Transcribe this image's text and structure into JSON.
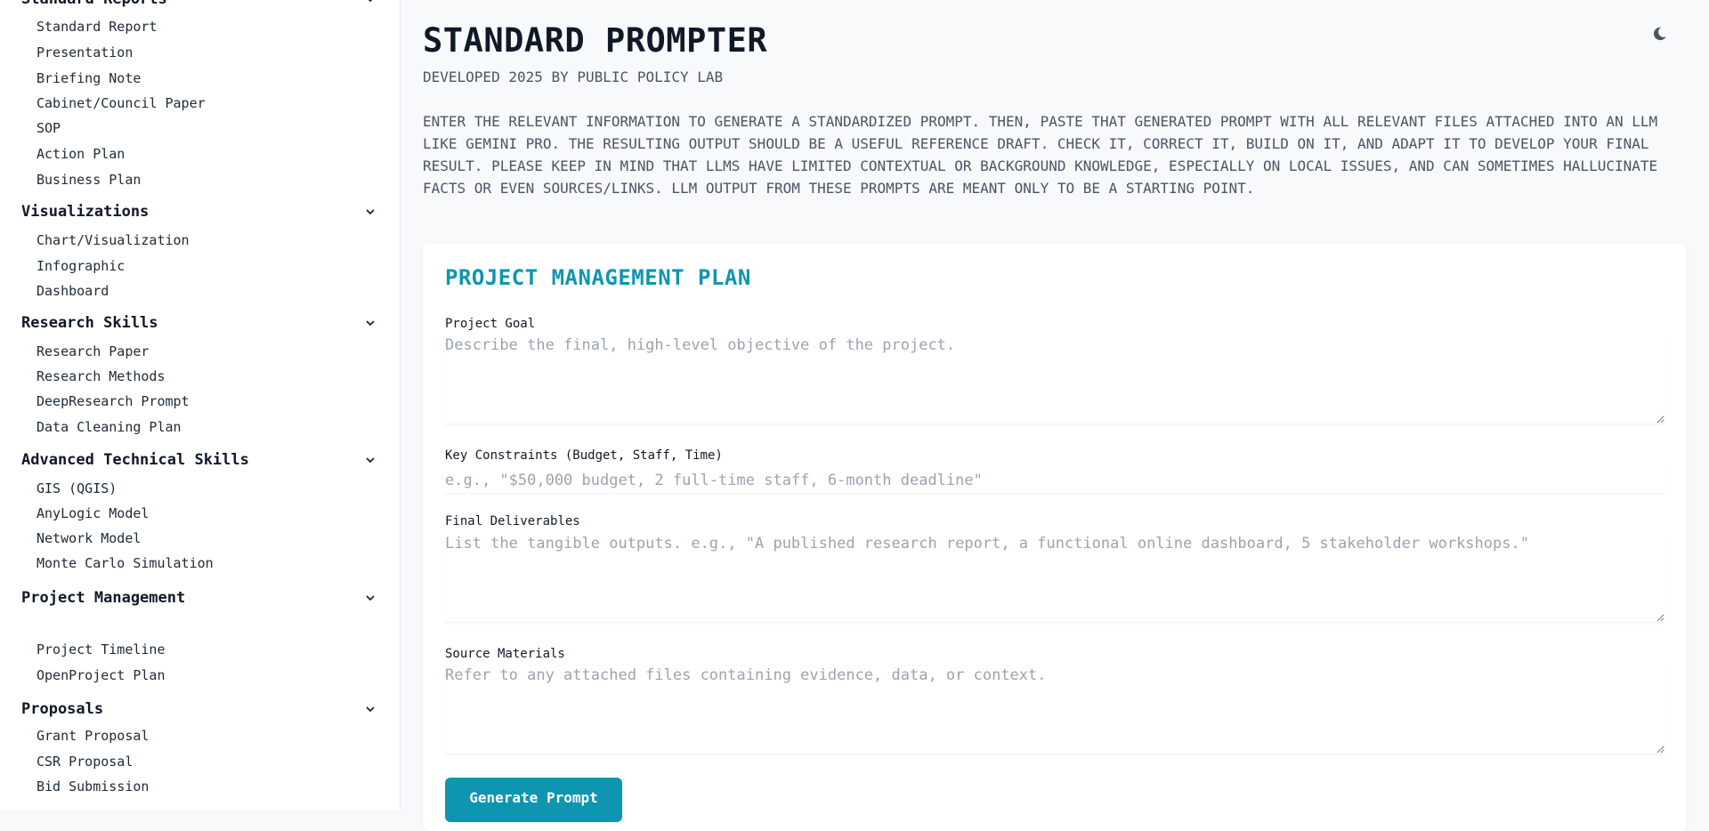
{
  "sidebar": {
    "sections": [
      {
        "title": "Standard Reports",
        "items": [
          "Standard Report",
          "Presentation",
          "Briefing Note",
          "Cabinet/Council Paper",
          "SOP",
          "Action Plan",
          "Business Plan"
        ]
      },
      {
        "title": "Visualizations",
        "items": [
          "Chart/Visualization",
          "Infographic",
          "Dashboard"
        ]
      },
      {
        "title": "Research Skills",
        "items": [
          "Research Paper",
          "Research Methods",
          "DeepResearch Prompt",
          "Data Cleaning Plan"
        ]
      },
      {
        "title": "Advanced Technical Skills",
        "items": [
          "GIS (QGIS)",
          "AnyLogic Model",
          "Network Model",
          "Monte Carlo Simulation"
        ]
      },
      {
        "title": "Project Management",
        "items": [
          "Project Timeline",
          "OpenProject Plan"
        ]
      },
      {
        "title": "Proposals",
        "items": [
          "Grant Proposal",
          "CSR Proposal",
          "Bid Submission"
        ]
      }
    ]
  },
  "header": {
    "title": "STANDARD PROMPTER",
    "subtitle": "DEVELOPED 2025 BY PUBLIC POLICY LAB",
    "intro": "ENTER THE RELEVANT INFORMATION TO GENERATE A STANDARDIZED PROMPT. THEN, PASTE THAT GENERATED PROMPT WITH ALL RELEVANT FILES ATTACHED INTO AN LLM LIKE GEMINI PRO. THE RESULTING OUTPUT SHOULD BE A USEFUL REFERENCE DRAFT. CHECK IT, CORRECT IT, BUILD ON IT, AND ADAPT IT TO DEVELOP YOUR FINAL RESULT. PLEASE KEEP IN MIND THAT LLMS HAVE LIMITED CONTEXTUAL OR BACKGROUND KNOWLEDGE, ESPECIALLY ON LOCAL ISSUES, AND CAN SOMETIMES HALLUCINATE FACTS OR EVEN SOURCES/LINKS. LLM OUTPUT FROM THESE PROMPTS ARE MEANT ONLY TO BE A STARTING POINT.",
    "theme_toggle_icon": "moon-icon"
  },
  "form": {
    "title": "PROJECT MANAGEMENT PLAN",
    "fields": [
      {
        "label": "Project Goal",
        "value": "",
        "placeholder": "Describe the final, high-level objective of the project."
      },
      {
        "label": "Key Constraints (Budget, Staff, Time)",
        "value": "",
        "placeholder": "e.g., \"$50,000 budget, 2 full-time staff, 6-month deadline\""
      },
      {
        "label": "Final Deliverables",
        "value": "",
        "placeholder": "List the tangible outputs. e.g., \"A published research report, a functional online dashboard, 5 stakeholder workshops.\""
      },
      {
        "label": "Source Materials",
        "value": "",
        "placeholder": "Refer to any attached files containing evidence, data, or context."
      }
    ],
    "submit_label": "Generate Prompt"
  },
  "colors": {
    "accent": "#0e96b1",
    "text": "#111827",
    "muted": "#4b5563",
    "placeholder": "#9ca3af",
    "background": "#f8f9fb"
  }
}
